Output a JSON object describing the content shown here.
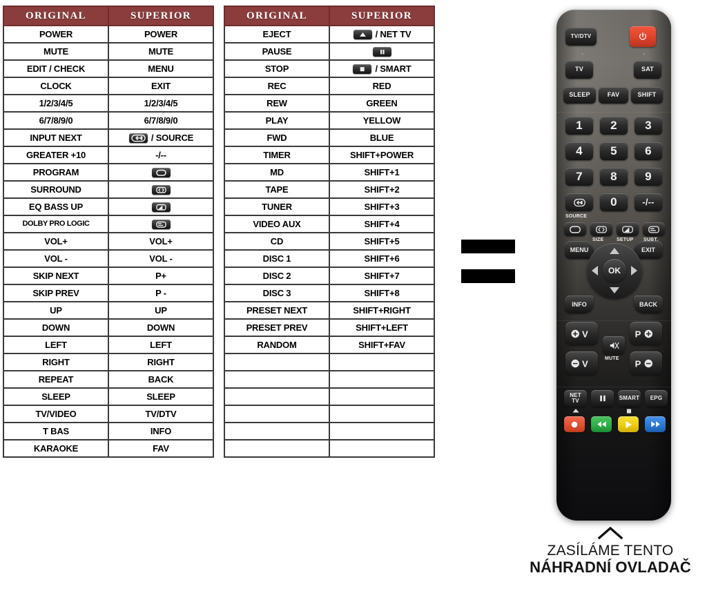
{
  "tables": [
    {
      "id": "table-a",
      "headers": [
        "ORIGINAL",
        "SUPERIOR"
      ],
      "rows": [
        {
          "original": "POWER",
          "superior": "POWER"
        },
        {
          "original": "MUTE",
          "superior": "MUTE"
        },
        {
          "original": "EDIT / CHECK",
          "superior": "MENU"
        },
        {
          "original": "CLOCK",
          "superior": "EXIT"
        },
        {
          "original": "1/2/3/4/5",
          "superior": "1/2/3/4/5"
        },
        {
          "original": "6/7/8/9/0",
          "superior": "6/7/8/9/0"
        },
        {
          "original": "INPUT NEXT",
          "superior": "/ SOURCE",
          "superior_icon": "source-input-icon"
        },
        {
          "original": "GREATER +10",
          "superior": "-/--"
        },
        {
          "original": "PROGRAM",
          "superior": "",
          "superior_icon": "screen-format-icon"
        },
        {
          "original": "SURROUND",
          "superior": "",
          "superior_icon": "picture-size-icon"
        },
        {
          "original": "EQ BASS UP",
          "superior": "",
          "superior_icon": "setup-icon"
        },
        {
          "original": "DOLBY PRO LOGIC",
          "superior": "",
          "superior_icon": "subtitle-icon"
        },
        {
          "original": "VOL+",
          "superior": "VOL+"
        },
        {
          "original": "VOL -",
          "superior": "VOL -"
        },
        {
          "original": "SKIP NEXT",
          "superior": "P+"
        },
        {
          "original": "SKIP PREV",
          "superior": "P -"
        },
        {
          "original": "UP",
          "superior": "UP"
        },
        {
          "original": "DOWN",
          "superior": "DOWN"
        },
        {
          "original": "LEFT",
          "superior": "LEFT"
        },
        {
          "original": "RIGHT",
          "superior": "RIGHT"
        },
        {
          "original": "REPEAT",
          "superior": "BACK"
        },
        {
          "original": "SLEEP",
          "superior": "SLEEP"
        },
        {
          "original": "TV/VIDEO",
          "superior": "TV/DTV"
        },
        {
          "original": "T BAS",
          "superior": "INFO"
        },
        {
          "original": "KARAOKE",
          "superior": "FAV"
        }
      ]
    },
    {
      "id": "table-b",
      "headers": [
        "ORIGINAL",
        "SUPERIOR"
      ],
      "rows": [
        {
          "original": "EJECT",
          "superior": "/ NET TV",
          "superior_icon": "eject-icon"
        },
        {
          "original": "PAUSE",
          "superior": "",
          "superior_icon": "pause-icon"
        },
        {
          "original": "STOP",
          "superior": "/ SMART",
          "superior_icon": "stop-icon"
        },
        {
          "original": "REC",
          "superior": "RED"
        },
        {
          "original": "REW",
          "superior": "GREEN"
        },
        {
          "original": "PLAY",
          "superior": "YELLOW"
        },
        {
          "original": "FWD",
          "superior": "BLUE"
        },
        {
          "original": "TIMER",
          "superior": "SHIFT+POWER"
        },
        {
          "original": "MD",
          "superior": "SHIFT+1"
        },
        {
          "original": "TAPE",
          "superior": "SHIFT+2"
        },
        {
          "original": "TUNER",
          "superior": "SHIFT+3"
        },
        {
          "original": "VIDEO AUX",
          "superior": "SHIFT+4"
        },
        {
          "original": "CD",
          "superior": "SHIFT+5"
        },
        {
          "original": "DISC 1",
          "superior": "SHIFT+6"
        },
        {
          "original": "DISC 2",
          "superior": "SHIFT+7"
        },
        {
          "original": "DISC 3",
          "superior": "SHIFT+8"
        },
        {
          "original": "PRESET NEXT",
          "superior": "SHIFT+RIGHT"
        },
        {
          "original": "PRESET PREV",
          "superior": "SHIFT+LEFT"
        },
        {
          "original": "RANDOM",
          "superior": "SHIFT+FAV"
        },
        {
          "original": "",
          "superior": ""
        },
        {
          "original": "",
          "superior": ""
        },
        {
          "original": "",
          "superior": ""
        },
        {
          "original": "",
          "superior": ""
        },
        {
          "original": "",
          "superior": ""
        },
        {
          "original": "",
          "superior": ""
        }
      ]
    }
  ],
  "redactions": [
    {
      "name": "redacted-bar-1"
    },
    {
      "name": "redacted-bar-2"
    }
  ],
  "remote": {
    "buttons": {
      "tv_dtv": "TV/DTV",
      "power": "power-icon",
      "tv": "TV",
      "sat": "SAT",
      "sleep": "SLEEP",
      "fav": "FAV",
      "shift": "SHIFT",
      "num_1": "1",
      "num_2": "2",
      "num_3": "3",
      "num_4": "4",
      "num_5": "5",
      "num_6": "6",
      "num_7": "7",
      "num_8": "8",
      "num_9": "9",
      "num_0": "0",
      "source": "source-input-icon",
      "dash": "-/--",
      "menu": "MENU",
      "exit": "EXIT",
      "ok": "OK",
      "info": "INFO",
      "back": "BACK",
      "mute": "MUTE",
      "vol_up": "VOL+",
      "vol_down": "VOL-",
      "prog_up": "P+",
      "prog_down": "P-",
      "net_tv": "NET TV",
      "pause": "pause-icon",
      "smart": "SMART",
      "epg": "EPG",
      "rec": "record-icon",
      "rew": "rewind-icon",
      "play": "play-icon",
      "fwd": "fast-forward-icon"
    },
    "captions": {
      "source": "SOURCE",
      "size": "SIZE",
      "setup": "SETUP",
      "subt": "SUBT."
    },
    "colors": {
      "power": "#e0452c",
      "record": "#e8543c",
      "rewind": "#2faf46",
      "play": "#f2d111",
      "forward": "#2a79d8"
    }
  },
  "footer": {
    "line1": "ZASÍLÁME TENTO",
    "line2": "NÁHRADNÍ OVLADAČ",
    "chevron": "chevron-up-icon"
  }
}
